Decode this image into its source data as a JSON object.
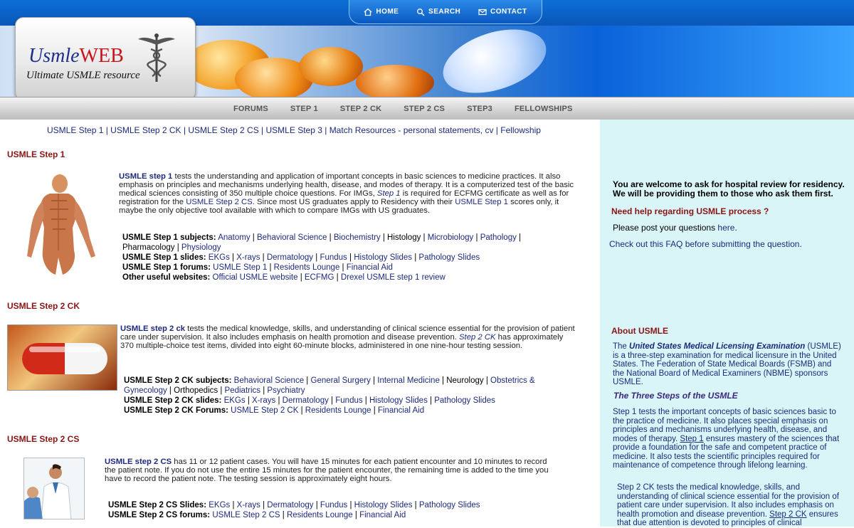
{
  "topnav": {
    "home": "HOME",
    "search": "SEARCH",
    "contact": "CONTACT"
  },
  "logo": {
    "usmle": "Usmle",
    "web": "WEB",
    "tagline": "Ultimate USMLE resource"
  },
  "mainnav": [
    "FORUMS",
    "STEP 1",
    "STEP 2 CK",
    "STEP 2 CS",
    "STEP3",
    "FELLOWSHIPS"
  ],
  "quicklinks": [
    "USMLE Step 1",
    "USMLE Step 2 CK",
    "USMLE Step 2 CS",
    "USMLE Step 3",
    "Match Resources - personal statements, cv",
    "Fellowship"
  ],
  "step1": {
    "heading": "USMLE Step 1",
    "lead": "USMLE step 1",
    "text1": " tests the understanding and application of important concepts in basic sciences to medicine practices. It also emphasis on principles and mechanisms underlying health, disease, and modes of therapy. It is a computerized test of the basic medical sciences consisting of 350 multiple choice questions. For IMGs, ",
    "ital": "Step 1",
    "text2": " is required for ECFMG certificate as well as for registration for the ",
    "link1": "USMLE Step 2 CS",
    "text3": ". Since most US graduates apply to Residency with their ",
    "link2": "USMLE Step 1",
    "text4": " scores only, it maybe the only objective tool available with which to compare IMGs with US graduates.",
    "subjects_label": "USMLE Step 1 subjects:",
    "subjects": [
      "Anatomy",
      "Behavioral Science",
      "Biochemistry",
      "Histology",
      "Microbiology",
      "Pathology",
      "Pharmacology",
      "Physiology"
    ],
    "slides_label": "USMLE Step 1 slides:",
    "slides": [
      "EKGs",
      "X-rays",
      "Dermatology",
      "Fundus",
      "Histology Slides",
      "Pathology Slides"
    ],
    "forums_label": "USMLE Step 1 forums:",
    "forums": [
      "USMLE Step 1",
      "Residents Lounge",
      "Financial Aid"
    ],
    "other_label": "Other useful websites:",
    "other": [
      "Official USMLE website",
      "ECFMG",
      "Drexel USMLE step 1 review"
    ]
  },
  "step2ck": {
    "heading": "USMLE Step 2 CK",
    "lead": "USMLE step 2 ck",
    "text1": " tests the medical knowledge, skills, and understanding of clinical science essential for the provision of patient care under supervision. It also includes emphasis on health promotion and disease prevention. ",
    "ital": "Step 2 CK",
    "text2": " has approximately 370 multiple-choice test items, divided into eight 60-minute blocks, administered in one nine-hour testing session.",
    "subjects_label": "USMLE Step 2 CK subjects:",
    "subjects": [
      "Behavioral Science",
      "General Surgery",
      "Internal Medicine",
      "Neurology",
      "Obstetrics & Gynecology",
      "Orthopedics",
      "Pediatrics",
      "Psychiatry"
    ],
    "slides_label": "USMLE Step 2 CK slides:",
    "slides": [
      "EKGs",
      "X-rays",
      "Dermatology",
      "Fundus",
      "Histology Slides",
      "Pathology Slides"
    ],
    "forums_label": "USMLE Step 2 CK Forums:",
    "forums": [
      "USMLE Step 2 CK",
      "Residents Lounge",
      "Financial Aid"
    ]
  },
  "step2cs": {
    "heading": "USMLE Step 2 CS",
    "lead": "USMLE step 2 CS",
    "text1": " has 11 or 12 patient cases. You will have 15 minutes for each patient encounter and 10 minutes to record the patient note. If you do not use the entire 15 minutes for the patient encounter, the remaining time is added to the time you have to record the patient note. The testing session is approximately eight hours.",
    "slides_label": "USMLE Step 2 CS Slides:",
    "slides": [
      "EKGs",
      "X-rays",
      "Dermatology",
      "Fundus",
      "Histology Slides",
      "Pathology Slides"
    ],
    "forums_label": "USMLE Step 2 CS forums:",
    "forums": [
      "USMLE Step 2 CS",
      "Residents Lounge",
      "Financial Aid"
    ]
  },
  "sidebar": {
    "welcome": "You are welcome to ask for hospital review for residency. We will be providing them to those who ask them first.",
    "help_heading": "Need help regarding USMLE process ?",
    "post_text": "Please post your questions ",
    "post_link": "here",
    "faq": "Check out this FAQ before submitting the question.",
    "about_heading": "About USMLE",
    "about_pre": "The ",
    "about_bold": "United States Medical Licensing Examination",
    "about_post": " (USMLE) is a three-step examination for medical licensure in the United States. The Federation of State Medical Boards (FSMB) and the National Board of Medical Examiners (NBME) sponsors USMLE.",
    "three_steps": "The Three Steps of the USMLE",
    "s1_link": "Step 1",
    "s1_text": " tests the important concepts of basic sciences basic to the practice of medicine. It also places special emphasis on principles and mechanisms underlying health, disease, and modes of therapy. ",
    "s1_link2": "Step 1",
    "s1_text2": " ensures mastery of the sciences that provide a foundation for the safe and competent practice of medicine. It also tests the scientific principles required for maintenance of competence through lifelong learning.",
    "s2_text": "Step 2 CK tests the medical knowledge, skills, and understanding of clinical science essential for the provision of patient care under supervision. It also includes emphasis on health promotion and disease prevention. ",
    "s2_link": "Step 2 CK",
    "s2_text2": " ensures that due attention is devoted to principles of clinical"
  }
}
